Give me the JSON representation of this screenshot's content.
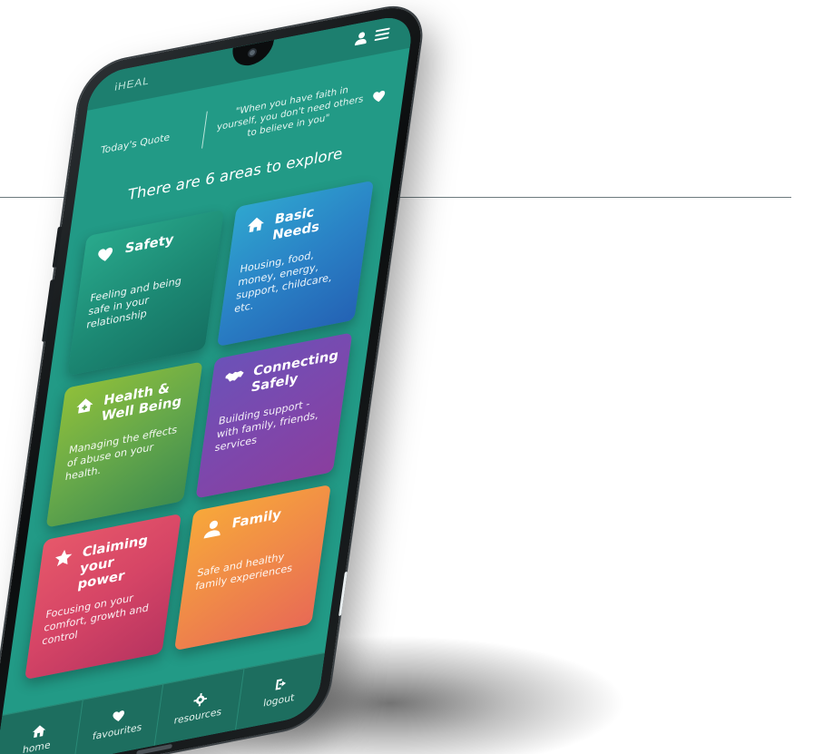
{
  "app": {
    "brand": "iHEAL"
  },
  "quote": {
    "label": "Today's Quote",
    "text": "\"When you have faith in yourself, you don't need others to believe in you\""
  },
  "section_title": "There are 6 areas to explore",
  "cards": [
    {
      "title": "Safety",
      "description": "Feeling and being safe in your relationship",
      "icon": "heart-icon",
      "color": "#1c8873"
    },
    {
      "title": "Basic Needs",
      "description": "Housing, food, money, energy, support, childcare, etc.",
      "icon": "home-icon",
      "color": "#2a82c6"
    },
    {
      "title": "Health & Well Being",
      "description": "Managing the effects of abuse on your health.",
      "icon": "health-house-icon",
      "color": "#66a84a"
    },
    {
      "title": "Connecting Safely",
      "description": "Building support - with family, friends, services",
      "icon": "handshake-icon",
      "color": "#7c48ad"
    },
    {
      "title": "Claiming your power",
      "description": "Focusing on your comfort, growth and control",
      "icon": "star-icon",
      "color": "#d64566"
    },
    {
      "title": "Family",
      "description": "Safe and healthy family experiences",
      "icon": "person-icon",
      "color": "#f08a48"
    }
  ],
  "nav": [
    {
      "label": "home",
      "icon": "home-icon"
    },
    {
      "label": "favourites",
      "icon": "heart-icon"
    },
    {
      "label": "resources",
      "icon": "gear-icon"
    },
    {
      "label": "logout",
      "icon": "logout-icon"
    }
  ]
}
